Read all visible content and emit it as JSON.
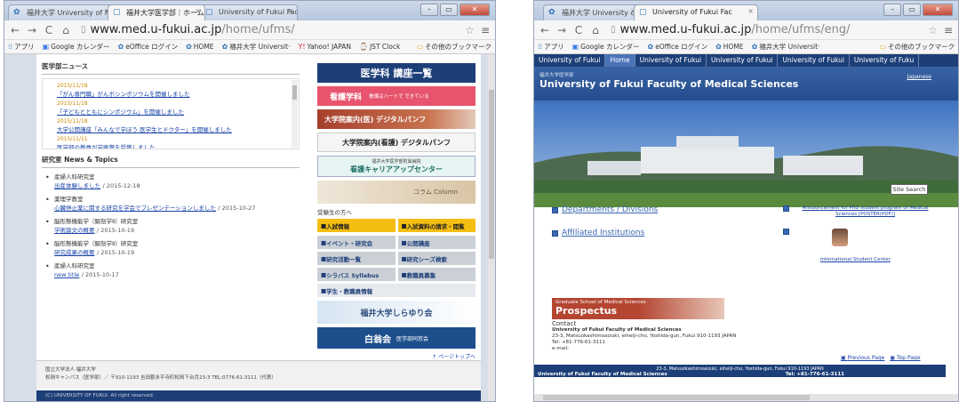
{
  "window1": {
    "tabs": [
      {
        "label": "福井大学 University of F"
      },
      {
        "label": "福井大学医学部｜ホーム"
      },
      {
        "label": "University of Fukui Fac"
      }
    ],
    "url_host": "www.med.u-fukui.ac.jp",
    "url_path": "/home/ufms/",
    "bookmarks": [
      "アプリ",
      "Google カレンダー",
      "eOffice ログイン",
      "HOME",
      "福井大学 Universit·",
      "Yahoo! JAPAN",
      "JST Clock"
    ],
    "bookmarks_other": "その他のブックマーク",
    "news_title": "医学部ニュース",
    "news": [
      {
        "date": "2015/11/18",
        "text": "「がん専門職」がんボシンポジウムを開催しました"
      },
      {
        "date": "2015/11/18",
        "text": "「子どもとともにシンポジウム」を開催しました"
      },
      {
        "date": "2015/11/18",
        "text": "大学公開講座「みんなで学ぼう 医学生とドクター」を開催しました"
      },
      {
        "date": "2015/11/11",
        "text": "医学部の教員が学術賞を受賞しました"
      }
    ],
    "topics_title": "研究室 News & Topics",
    "topics": [
      {
        "cat": "産婦人科研究室",
        "link": "出産体験しました",
        "date": "/ 2015-12-18"
      },
      {
        "cat": "薬理学教室",
        "link": "心臓停止薬に関する研究を学会でプレゼンテーションしました",
        "date": "/ 2015-10-27"
      },
      {
        "cat": "脳形態機能学（解剖学Ⅱ）研究室",
        "link": "学術論文の概要",
        "date": "/ 2015-10-19"
      },
      {
        "cat": "脳形態機能学（解剖学Ⅱ）研究室",
        "link": "研究成果の概要",
        "date": "/ 2015-10-19"
      },
      {
        "cat": "産婦人科研究室",
        "link": "new title",
        "date": "/ 2015-10-17"
      }
    ],
    "banners": {
      "course_list": "医学科 講座一覧",
      "nursing": "看護学科",
      "nursing_sub": "看護はハートで できている",
      "grad_med": "大学院案内(医) デジタルパンフ",
      "grad_nursing": "大学院案内(看護) デジタルパンフ",
      "career_sub": "福井大学医学部附属病院",
      "career": "看護キャリアアップセンター",
      "column": "コラム Column"
    },
    "exam_heading": "受験生の方へ",
    "exam_buttons": [
      "入試情報",
      "入試資料の請求・閲覧"
    ],
    "links": [
      "イベント・研究会",
      "公開講座",
      "研究活動一覧",
      "研究シーズ検索",
      "シラバス Syllabus",
      "教職員募集",
      "学生・教職員情報"
    ],
    "shirayuri": "福井大学しらゆり会",
    "hakuei": "白翁会",
    "hakuei_sub": "医学部同窓会",
    "pagetop": "↑ ページトップへ",
    "footer_line1": "国立大学法人 福井大学",
    "footer_line2": "松岡キャンパス（医学部）／ 〒910-1193 吉田郡永平寺町松岡下合月23-3 TEL:0776-61-3111（代表）",
    "copyright": "(C) UNIVERSITY OF FUKUI. All right reserved."
  },
  "window2": {
    "tabs": [
      {
        "label": "福井大学 University of F"
      },
      {
        "label": "University of Fukui Fac"
      }
    ],
    "url_host": "www.med.u-fukui.ac.jp",
    "url_path": "/home/ufms/eng/",
    "bookmarks": [
      "アプリ",
      "Google カレンダー",
      "eOffice ログイン",
      "HOME",
      "福井大学 Universit·"
    ],
    "bookmarks_other": "その他のブックマーク",
    "nav": [
      "University of Fukui",
      "Home",
      "University of Fukui",
      "University of Fukui",
      "University of Fukui",
      "University of Fuku"
    ],
    "header_sub": "福井大学医学部",
    "header_title": "University of Fukui Faculty of Medical Sciences",
    "japanese_link": "Japanese",
    "site_search": "Site Search",
    "link_departments": "Departments / Divisions",
    "link_affiliated": "Affiliated Institutions",
    "prospectus_sub": "Graduate School of Medical Sciences",
    "prospectus_title": "Prospectus",
    "contact_h": "Contact",
    "contact_lines": [
      "University of Fukui Faculty of Medical Sciences",
      "23-3, Matsuokashimoaizuki, eiheiji-cho, Yoshida-gun, Fukui 910-1193 JAPAN",
      "Tel: +81-776-61-3111",
      "e-mail:"
    ],
    "announcement": "Announcement for PhD student program of Medical Sciences [POSTER(PDF)]",
    "isc": "International Student Center",
    "previous_page": "Previous Page",
    "top_page": "Top Page",
    "footer_addr": "23-3, Matsuokashimoaizuki, eiheiji-cho, Yoshida-gun, Fukui 910-1193 JAPAN",
    "footer_name": "University of Fukui Faculty of Medical Sciences",
    "footer_tel": "Tel: +81-776-61-3111"
  }
}
